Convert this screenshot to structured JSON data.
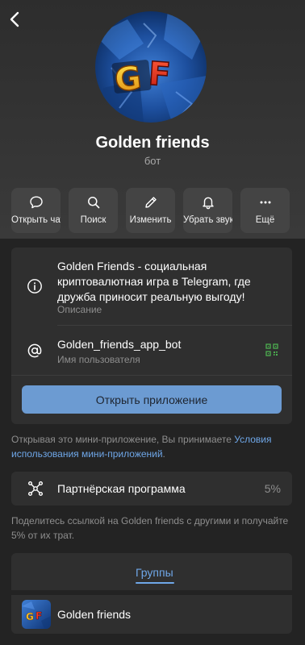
{
  "profile": {
    "name": "Golden friends",
    "type": "бот",
    "logo_text": "GF"
  },
  "actions": [
    {
      "label": "Открыть чат",
      "icon": "chat-bubble-icon"
    },
    {
      "label": "Поиск",
      "icon": "search-icon"
    },
    {
      "label": "Изменить",
      "icon": "pencil-icon"
    },
    {
      "label": "Убрать звук",
      "icon": "bell-icon"
    },
    {
      "label": "Ещё",
      "icon": "more-dots-icon"
    }
  ],
  "info": {
    "description": "Golden Friends - социальная криптовалютная игра в Telegram, где дружба приносит реальную выгоду!",
    "description_caption": "Описание",
    "username": "Golden_friends_app_bot",
    "username_caption": "Имя пользователя",
    "open_app_label": "Открыть приложение"
  },
  "terms_note": {
    "prefix": "Открывая это мини-приложение, Вы принимаете ",
    "link": "Условия использования мини-приложений",
    "suffix": "."
  },
  "partner": {
    "label": "Партнёрская программа",
    "value": "5%",
    "note": "Поделитесь ссылкой на Golden friends с другими и получайте 5% от их трат."
  },
  "groups": {
    "tab_label": "Группы",
    "items": [
      {
        "name": "Golden friends",
        "logo_text": "GF"
      }
    ]
  },
  "colors": {
    "accent": "#6fa7e8",
    "button": "#6c9bd2",
    "background": "#232323",
    "card": "#2f2f2f"
  }
}
